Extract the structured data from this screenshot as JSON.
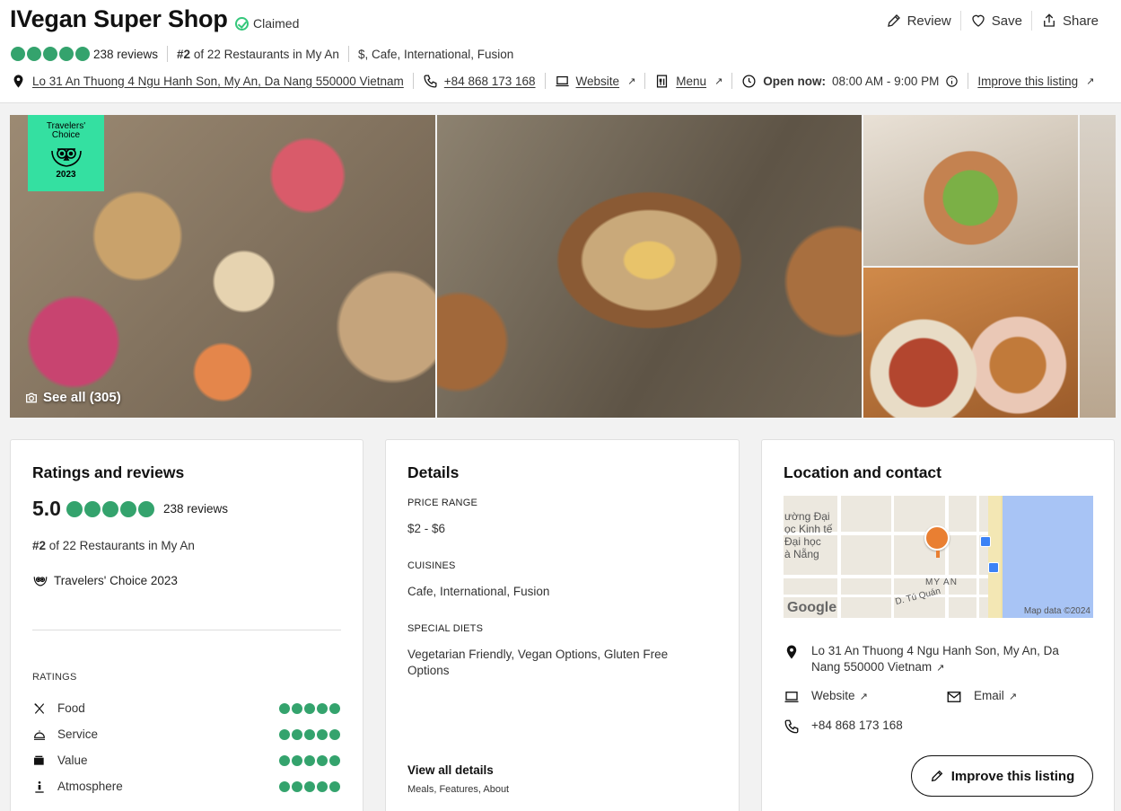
{
  "header": {
    "title": "IVegan Super Shop",
    "claimed": "Claimed",
    "actions": {
      "review": "Review",
      "save": "Save",
      "share": "Share"
    },
    "reviews": "238 reviews",
    "rank_num": "#2",
    "rank_rest": "of 22 Restaurants in My An",
    "tags": "$, Cafe, International, Fusion",
    "address": "Lo 31 An Thuong 4 Ngu Hanh Son, My An, Da Nang 550000 Vietnam",
    "phone": "+84 868 173 168",
    "website": "Website",
    "menu": "Menu",
    "open_label": "Open now:",
    "hours": "08:00 AM - 9:00 PM",
    "improve": "Improve this listing",
    "bubble_rating": 5
  },
  "photos": {
    "badge_line1": "Travelers'",
    "badge_line2": "Choice",
    "badge_year": "2023",
    "see_all": "See all (305)"
  },
  "ratings_card": {
    "title": "Ratings and reviews",
    "score": "5.0",
    "reviews": "238 reviews",
    "rank_num": "#2",
    "rank_rest": "of 22 Restaurants in My An",
    "award": "Travelers' Choice 2023",
    "ratings_label": "RATINGS",
    "rows": [
      {
        "name": "Food",
        "icon": "utensils-icon",
        "value": 5
      },
      {
        "name": "Service",
        "icon": "service-bell-icon",
        "value": 5
      },
      {
        "name": "Value",
        "icon": "wallet-icon",
        "value": 5
      },
      {
        "name": "Atmosphere",
        "icon": "atmosphere-icon",
        "value": 5
      }
    ]
  },
  "details_card": {
    "title": "Details",
    "price_label": "PRICE RANGE",
    "price_value": "$2 - $6",
    "cuisines_label": "CUISINES",
    "cuisines_value": "Cafe, International, Fusion",
    "diets_label": "SPECIAL DIETS",
    "diets_value": "Vegetarian Friendly, Vegan Options, Gluten Free Options",
    "view_all": "View all details",
    "view_all_sub": "Meals, Features, About"
  },
  "location_card": {
    "title": "Location and contact",
    "map": {
      "label_1": "ường Đại",
      "label_2": "ọc Kinh tế",
      "label_3": "Đại học",
      "label_4": "à Nẵng",
      "label_myan": "MY AN",
      "label_street": "D. Tú Quán",
      "google": "Google",
      "map_data": "Map data ©2024"
    },
    "address": "Lo 31 An Thuong 4 Ngu Hanh Son, My An, Da Nang 550000 Vietnam",
    "website": "Website",
    "email": "Email",
    "phone": "+84 868 173 168",
    "improve": "Improve this listing"
  },
  "colors": {
    "bubble": "#34a36d",
    "badge": "#34e0a1",
    "claimed": "#34c77b",
    "pin": "#e97f32",
    "sea": "#a8c4f5"
  }
}
